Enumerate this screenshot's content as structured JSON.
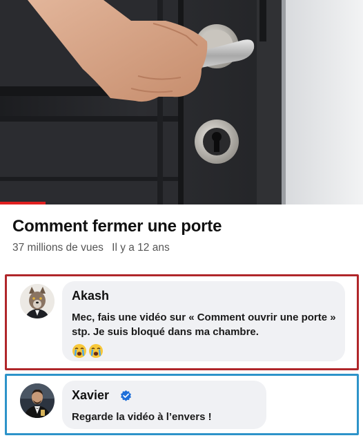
{
  "video": {
    "title": "Comment fermer une porte",
    "views": "37 millions de vues",
    "age": "Il y a 12 ans",
    "progress_fraction": 0.125
  },
  "comments": [
    {
      "author": "Akash",
      "text": "Mec, fais une vidéo sur « Comment ouvrir une porte » stp. Je suis bloqué dans ma chambre.",
      "emojis": [
        "crying-face",
        "crying-face"
      ],
      "verified": false,
      "frame_color": "#b0262a"
    },
    {
      "author": "Xavier",
      "text": "Regarde la vidéo à l’envers !",
      "verified": true,
      "frame_color": "#2d93c9"
    }
  ],
  "colors": {
    "progress": "#e02020",
    "verified_badge": "#1e6fd9",
    "bubble": "#f0f1f4"
  }
}
